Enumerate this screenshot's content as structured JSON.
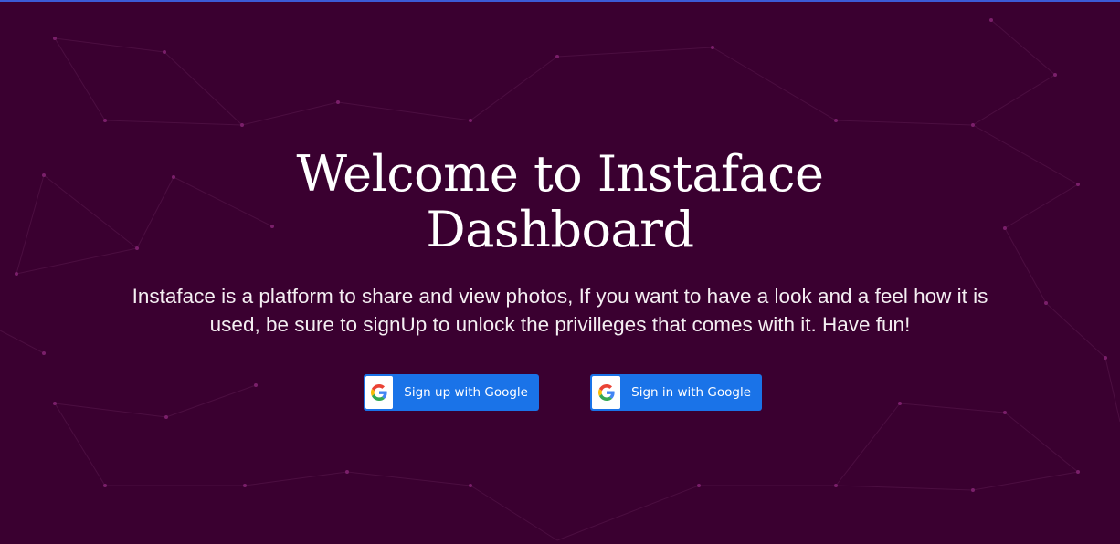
{
  "page": {
    "background_color": "#3a0030",
    "accent_line_color": "#3b5bd6"
  },
  "hero": {
    "title": "Welcome to Instaface Dashboard",
    "tagline": "Instaface is a platform to share and view photos, If you want to have a look and a feel how it is used, be sure to signUp to unlock the privilleges that comes with it. Have fun!"
  },
  "auth": {
    "signup_label": "Sign up with Google",
    "signin_label": "Sign in with Google",
    "button_color": "#1a73e8",
    "icon": "google-g-icon"
  }
}
